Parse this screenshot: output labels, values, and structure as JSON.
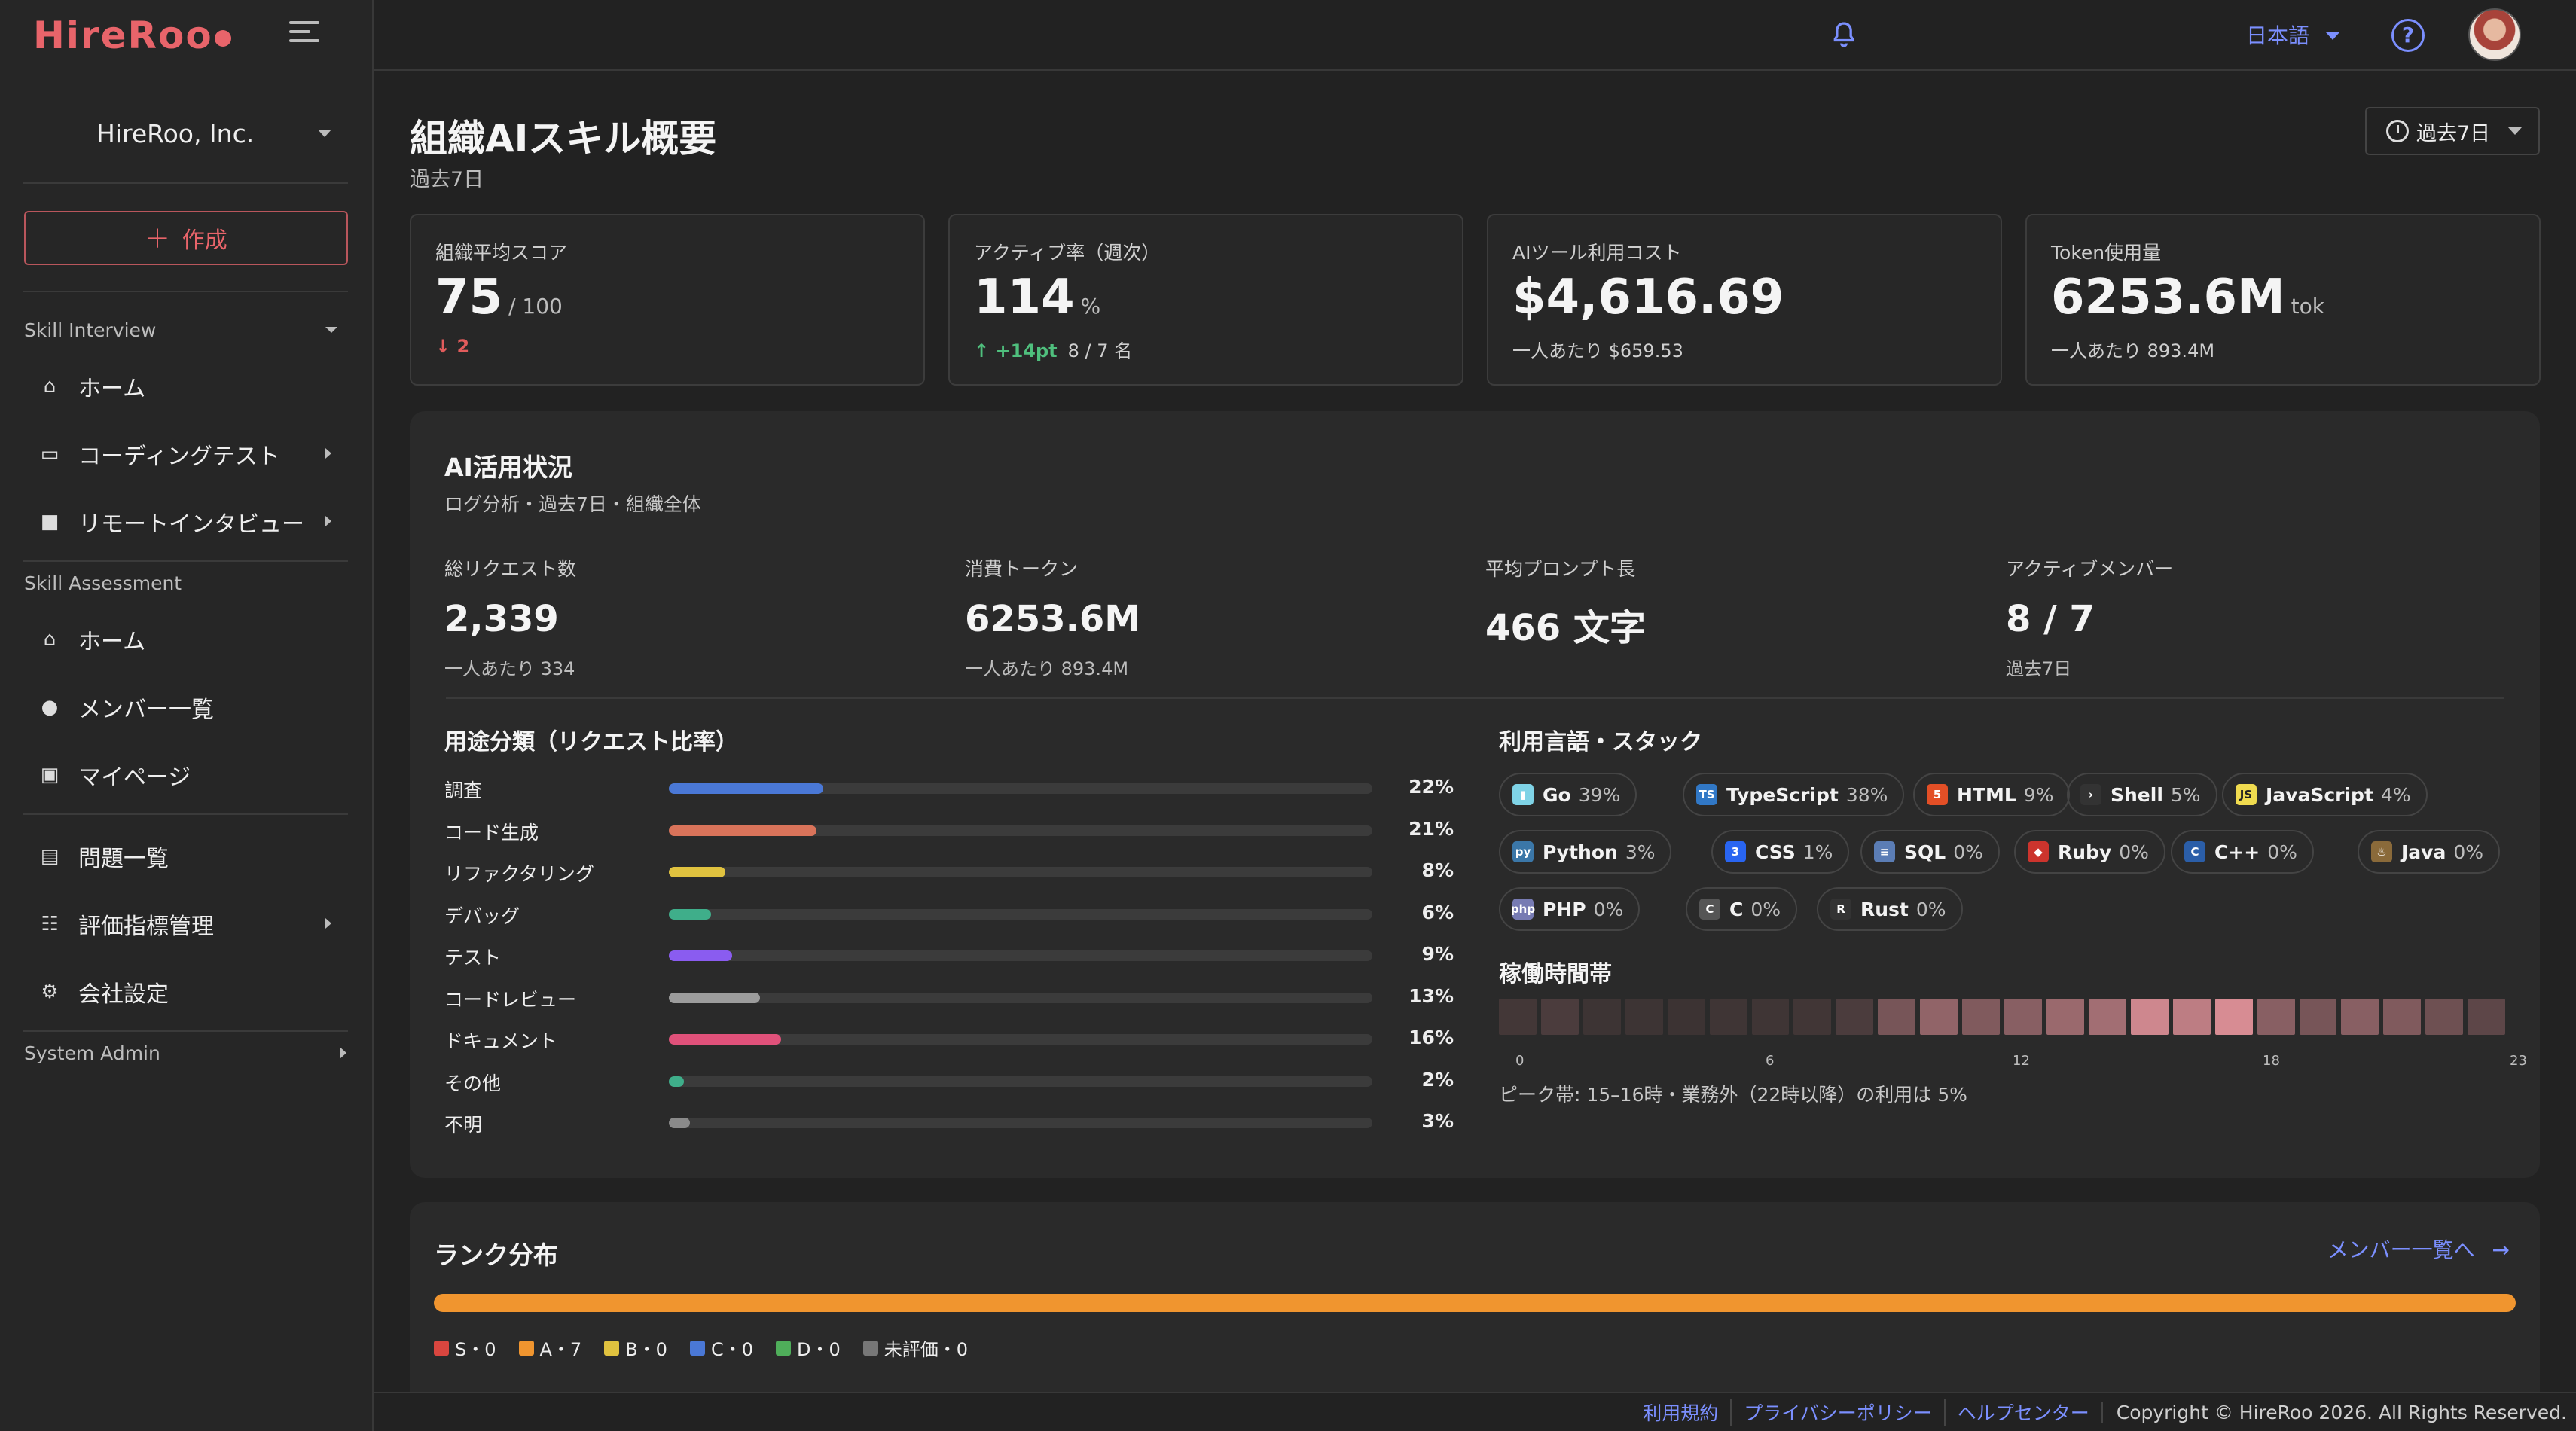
{
  "brand": {
    "logo_text": "HireRoo",
    "accent": "#e8646a"
  },
  "sidebar": {
    "org_name": "HireRoo, Inc.",
    "create_label": "作成",
    "sections": [
      {
        "label": "Skill Interview",
        "items": [
          {
            "label": "ホーム",
            "icon": "home-icon"
          },
          {
            "label": "コーディングテスト",
            "icon": "monitor-icon"
          },
          {
            "label": "リモートインタビュー",
            "icon": "video-icon"
          }
        ]
      },
      {
        "label": "Skill Assessment",
        "items": [
          {
            "label": "ホーム",
            "icon": "home-icon"
          },
          {
            "label": "メンバー一覧",
            "icon": "person-icon"
          },
          {
            "label": "マイページ",
            "icon": "badge-icon"
          }
        ]
      },
      {
        "label": "",
        "items": [
          {
            "label": "問題一覧",
            "icon": "document-icon"
          },
          {
            "label": "評価指標管理",
            "icon": "list-icon"
          },
          {
            "label": "会社設定",
            "icon": "gear-icon"
          }
        ]
      }
    ],
    "system_admin": "System Admin"
  },
  "topbar": {
    "language": "日本語"
  },
  "page": {
    "title": "組織AIスキル概要",
    "subtitle": "過去7日",
    "period": "過去7日"
  },
  "kpis": [
    {
      "label": "組織平均スコア",
      "value": "75",
      "unit": "/ 100",
      "delta": "2",
      "sub": ""
    },
    {
      "label": "アクティブ率（週次）",
      "value": "114",
      "unit": "%",
      "delta": "+14pt",
      "sub": "8 / 7 名"
    },
    {
      "label": "AIツール利用コスト",
      "value": "$4,616.69",
      "unit": "",
      "delta": "",
      "sub": "一人あたり $659.53"
    },
    {
      "label": "Token使用量",
      "value": "6253.6M",
      "unit": "tok",
      "delta": "",
      "sub": "一人あたり 893.4M"
    }
  ],
  "ai_usage": {
    "title": "AI活用状況",
    "subtitle": "ログ分析・過去7日・組織全体",
    "stats": [
      {
        "label": "総リクエスト数",
        "value": "2,339",
        "sub": "一人あたり 334"
      },
      {
        "label": "消費トークン",
        "value": "6253.6M",
        "sub": "一人あたり 893.4M"
      },
      {
        "label": "平均プロンプト長",
        "value": "466 文字",
        "sub": ""
      },
      {
        "label": "アクティブメンバー",
        "value": "8 / 7",
        "sub": "過去7日"
      }
    ],
    "purpose_title": "用途分類（リクエスト比率）",
    "purposes": [
      {
        "label": "調査",
        "pct": 22,
        "pct_label": "22%",
        "color": "#4a78d6"
      },
      {
        "label": "コード生成",
        "pct": 21,
        "pct_label": "21%",
        "color": "#d9735a"
      },
      {
        "label": "リファクタリング",
        "pct": 8,
        "pct_label": "8%",
        "color": "#e0c23f"
      },
      {
        "label": "デバッグ",
        "pct": 6,
        "pct_label": "6%",
        "color": "#3fae8a"
      },
      {
        "label": "テスト",
        "pct": 9,
        "pct_label": "9%",
        "color": "#8a5cf0"
      },
      {
        "label": "コードレビュー",
        "pct": 13,
        "pct_label": "13%",
        "color": "#9c9c9c"
      },
      {
        "label": "ドキュメント",
        "pct": 16,
        "pct_label": "16%",
        "color": "#e0517a"
      },
      {
        "label": "その他",
        "pct": 2,
        "pct_label": "2%",
        "color": "#3fae8a"
      },
      {
        "label": "不明",
        "pct": 3,
        "pct_label": "3%",
        "color": "#8a8a8a"
      }
    ],
    "lang_title": "利用言語・スタック",
    "languages": [
      {
        "name": "Go",
        "pct": "39%",
        "icon": "go-icon",
        "color": "#7fd3e6",
        "glyph": "▮"
      },
      {
        "name": "TypeScript",
        "pct": "38%",
        "icon": "typescript-icon",
        "color": "#3178c6",
        "glyph": "TS"
      },
      {
        "name": "HTML",
        "pct": "9%",
        "icon": "html-icon",
        "color": "#e34f26",
        "glyph": "5"
      },
      {
        "name": "Shell",
        "pct": "5%",
        "icon": "shell-icon",
        "color": "#333333",
        "glyph": "›"
      },
      {
        "name": "JavaScript",
        "pct": "4%",
        "icon": "javascript-icon",
        "color": "#f0db4f",
        "glyph": "JS"
      },
      {
        "name": "Python",
        "pct": "3%",
        "icon": "python-icon",
        "color": "#3b77a8",
        "glyph": "py"
      },
      {
        "name": "CSS",
        "pct": "1%",
        "icon": "css-icon",
        "color": "#2965f1",
        "glyph": "3"
      },
      {
        "name": "SQL",
        "pct": "0%",
        "icon": "database-icon",
        "color": "#5b7db5",
        "glyph": "≡"
      },
      {
        "name": "Ruby",
        "pct": "0%",
        "icon": "ruby-icon",
        "color": "#cc342d",
        "glyph": "◆"
      },
      {
        "name": "C++",
        "pct": "0%",
        "icon": "cplusplus-icon",
        "color": "#2b5ea8",
        "glyph": "C"
      },
      {
        "name": "Java",
        "pct": "0%",
        "icon": "java-icon",
        "color": "#8a6a3a",
        "glyph": "♨"
      },
      {
        "name": "PHP",
        "pct": "0%",
        "icon": "php-icon",
        "color": "#777bb3",
        "glyph": "php"
      },
      {
        "name": "C",
        "pct": "0%",
        "icon": "c-icon",
        "color": "#555555",
        "glyph": "C"
      },
      {
        "name": "Rust",
        "pct": "0%",
        "icon": "rust-icon",
        "color": "#333333",
        "glyph": "R"
      }
    ],
    "heatmap_title": "稼働時間帯",
    "heatmap": [
      0.05,
      0.1,
      0.02,
      0.02,
      0.01,
      0.03,
      0.03,
      0.04,
      0.1,
      0.35,
      0.5,
      0.4,
      0.45,
      0.55,
      0.6,
      0.85,
      0.75,
      0.9,
      0.45,
      0.35,
      0.45,
      0.4,
      0.3,
      0.2
    ],
    "hour_labels": [
      "0",
      "6",
      "12",
      "18",
      "23"
    ],
    "heat_note": "ピーク帯: 15–16時・業務外（22時以降）の利用は 5%"
  },
  "rank": {
    "title": "ランク分布",
    "link": "メンバー一覧へ",
    "legend": [
      {
        "label": "S・0",
        "color": "#d9463f"
      },
      {
        "label": "A・7",
        "color": "#f0952f"
      },
      {
        "label": "B・0",
        "color": "#e0c23f"
      },
      {
        "label": "C・0",
        "color": "#4a78d6"
      },
      {
        "label": "D・0",
        "color": "#4fae5a"
      },
      {
        "label": "未評価・0",
        "color": "#777777"
      }
    ]
  },
  "footer": {
    "links": [
      "利用規約",
      "プライバシーポリシー",
      "ヘルプセンター"
    ],
    "copyright": "Copyright © HireRoo 2026. All Rights Reserved."
  }
}
